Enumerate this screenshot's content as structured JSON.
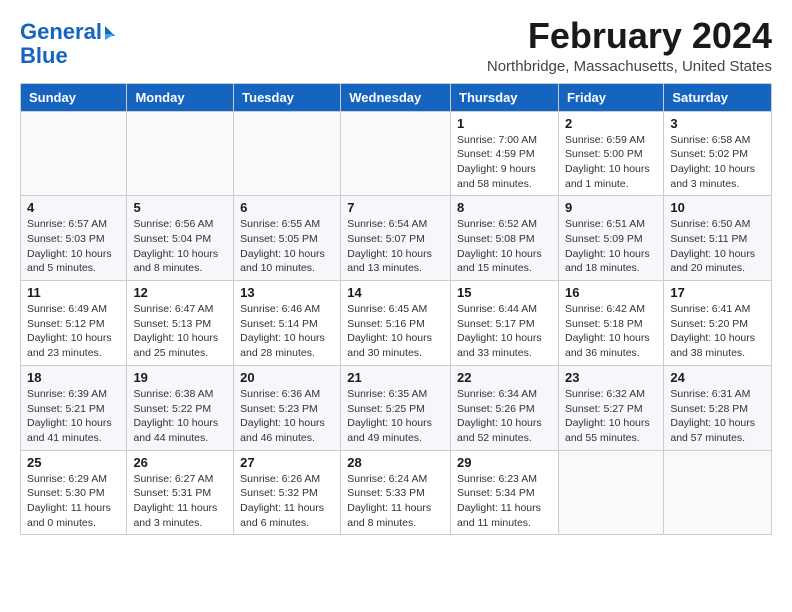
{
  "logo": {
    "line1": "General",
    "line2": "Blue"
  },
  "title": "February 2024",
  "location": "Northbridge, Massachusetts, United States",
  "weekdays": [
    "Sunday",
    "Monday",
    "Tuesday",
    "Wednesday",
    "Thursday",
    "Friday",
    "Saturday"
  ],
  "weeks": [
    [
      {
        "day": "",
        "info": ""
      },
      {
        "day": "",
        "info": ""
      },
      {
        "day": "",
        "info": ""
      },
      {
        "day": "",
        "info": ""
      },
      {
        "day": "1",
        "info": "Sunrise: 7:00 AM\nSunset: 4:59 PM\nDaylight: 9 hours\nand 58 minutes."
      },
      {
        "day": "2",
        "info": "Sunrise: 6:59 AM\nSunset: 5:00 PM\nDaylight: 10 hours\nand 1 minute."
      },
      {
        "day": "3",
        "info": "Sunrise: 6:58 AM\nSunset: 5:02 PM\nDaylight: 10 hours\nand 3 minutes."
      }
    ],
    [
      {
        "day": "4",
        "info": "Sunrise: 6:57 AM\nSunset: 5:03 PM\nDaylight: 10 hours\nand 5 minutes."
      },
      {
        "day": "5",
        "info": "Sunrise: 6:56 AM\nSunset: 5:04 PM\nDaylight: 10 hours\nand 8 minutes."
      },
      {
        "day": "6",
        "info": "Sunrise: 6:55 AM\nSunset: 5:05 PM\nDaylight: 10 hours\nand 10 minutes."
      },
      {
        "day": "7",
        "info": "Sunrise: 6:54 AM\nSunset: 5:07 PM\nDaylight: 10 hours\nand 13 minutes."
      },
      {
        "day": "8",
        "info": "Sunrise: 6:52 AM\nSunset: 5:08 PM\nDaylight: 10 hours\nand 15 minutes."
      },
      {
        "day": "9",
        "info": "Sunrise: 6:51 AM\nSunset: 5:09 PM\nDaylight: 10 hours\nand 18 minutes."
      },
      {
        "day": "10",
        "info": "Sunrise: 6:50 AM\nSunset: 5:11 PM\nDaylight: 10 hours\nand 20 minutes."
      }
    ],
    [
      {
        "day": "11",
        "info": "Sunrise: 6:49 AM\nSunset: 5:12 PM\nDaylight: 10 hours\nand 23 minutes."
      },
      {
        "day": "12",
        "info": "Sunrise: 6:47 AM\nSunset: 5:13 PM\nDaylight: 10 hours\nand 25 minutes."
      },
      {
        "day": "13",
        "info": "Sunrise: 6:46 AM\nSunset: 5:14 PM\nDaylight: 10 hours\nand 28 minutes."
      },
      {
        "day": "14",
        "info": "Sunrise: 6:45 AM\nSunset: 5:16 PM\nDaylight: 10 hours\nand 30 minutes."
      },
      {
        "day": "15",
        "info": "Sunrise: 6:44 AM\nSunset: 5:17 PM\nDaylight: 10 hours\nand 33 minutes."
      },
      {
        "day": "16",
        "info": "Sunrise: 6:42 AM\nSunset: 5:18 PM\nDaylight: 10 hours\nand 36 minutes."
      },
      {
        "day": "17",
        "info": "Sunrise: 6:41 AM\nSunset: 5:20 PM\nDaylight: 10 hours\nand 38 minutes."
      }
    ],
    [
      {
        "day": "18",
        "info": "Sunrise: 6:39 AM\nSunset: 5:21 PM\nDaylight: 10 hours\nand 41 minutes."
      },
      {
        "day": "19",
        "info": "Sunrise: 6:38 AM\nSunset: 5:22 PM\nDaylight: 10 hours\nand 44 minutes."
      },
      {
        "day": "20",
        "info": "Sunrise: 6:36 AM\nSunset: 5:23 PM\nDaylight: 10 hours\nand 46 minutes."
      },
      {
        "day": "21",
        "info": "Sunrise: 6:35 AM\nSunset: 5:25 PM\nDaylight: 10 hours\nand 49 minutes."
      },
      {
        "day": "22",
        "info": "Sunrise: 6:34 AM\nSunset: 5:26 PM\nDaylight: 10 hours\nand 52 minutes."
      },
      {
        "day": "23",
        "info": "Sunrise: 6:32 AM\nSunset: 5:27 PM\nDaylight: 10 hours\nand 55 minutes."
      },
      {
        "day": "24",
        "info": "Sunrise: 6:31 AM\nSunset: 5:28 PM\nDaylight: 10 hours\nand 57 minutes."
      }
    ],
    [
      {
        "day": "25",
        "info": "Sunrise: 6:29 AM\nSunset: 5:30 PM\nDaylight: 11 hours\nand 0 minutes."
      },
      {
        "day": "26",
        "info": "Sunrise: 6:27 AM\nSunset: 5:31 PM\nDaylight: 11 hours\nand 3 minutes."
      },
      {
        "day": "27",
        "info": "Sunrise: 6:26 AM\nSunset: 5:32 PM\nDaylight: 11 hours\nand 6 minutes."
      },
      {
        "day": "28",
        "info": "Sunrise: 6:24 AM\nSunset: 5:33 PM\nDaylight: 11 hours\nand 8 minutes."
      },
      {
        "day": "29",
        "info": "Sunrise: 6:23 AM\nSunset: 5:34 PM\nDaylight: 11 hours\nand 11 minutes."
      },
      {
        "day": "",
        "info": ""
      },
      {
        "day": "",
        "info": ""
      }
    ]
  ]
}
